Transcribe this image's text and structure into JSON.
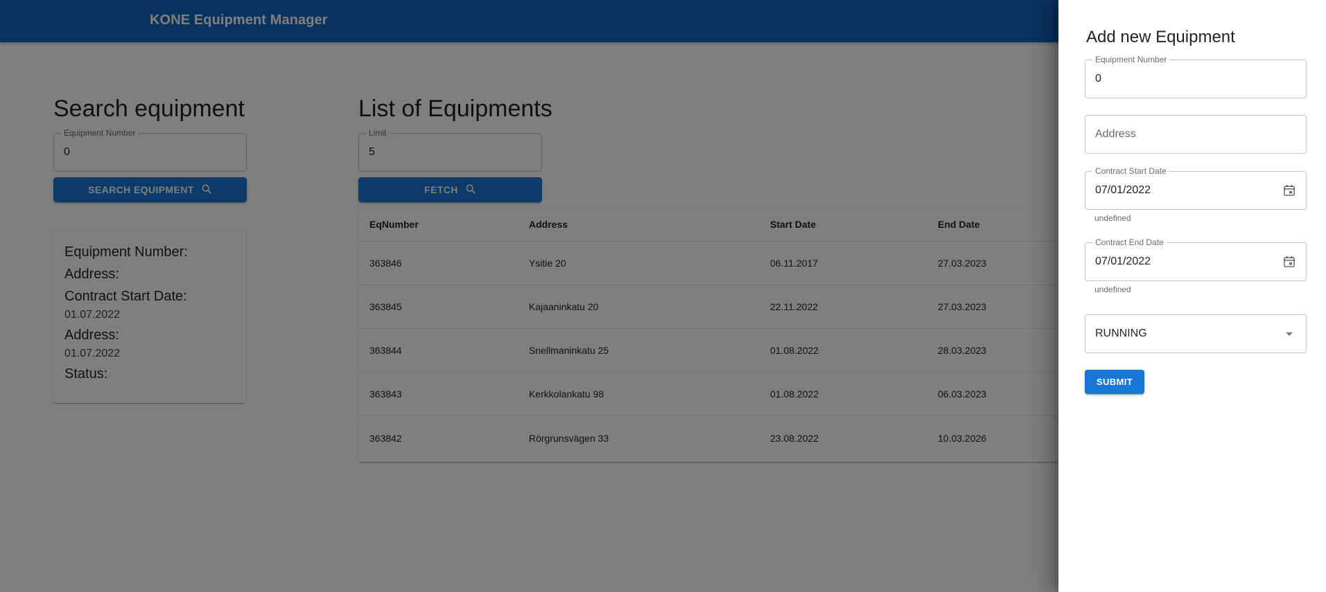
{
  "header": {
    "title": "KONE Equipment Manager"
  },
  "search": {
    "title": "Search equipment",
    "field_label": "Equipment Number",
    "field_value": "0",
    "button_label": "Search equipment"
  },
  "result_card": {
    "equipment_number_label": "Equipment Number:",
    "address_label": "Address:",
    "contract_start_label": "Contract Start Date:",
    "contract_start_value": "01.07.2022",
    "address2_label": "Address:",
    "address2_value": "01.07.2022",
    "status_label": "Status:"
  },
  "list": {
    "title": "List of Equipments",
    "limit_label": "Limit",
    "limit_value": "5",
    "fetch_label": "Fetch",
    "columns": [
      "EqNumber",
      "Address",
      "Start Date",
      "End Date"
    ],
    "rows": [
      [
        "363846",
        "Ysitie 20",
        "06.11.2017",
        "27.03.2023"
      ],
      [
        "363845",
        "Kajaaninkatu 20",
        "22.11.2022",
        "27.03.2023"
      ],
      [
        "363844",
        "Snellmaninkatu 25",
        "01.08.2022",
        "28.03.2023"
      ],
      [
        "363843",
        "Kerkkolankatu 98",
        "01.08.2022",
        "06.03.2023"
      ],
      [
        "363842",
        "Rörgrunsvägen 33",
        "23.08.2022",
        "10.03.2026"
      ]
    ]
  },
  "drawer": {
    "title": "Add new Equipment",
    "equipment_number_label": "Equipment Number",
    "equipment_number_value": "0",
    "address_placeholder": "Address",
    "contract_start_label": "Contract Start Date",
    "contract_start_value": "07/01/2022",
    "contract_start_helper": "undefined",
    "contract_end_label": "Contract End Date",
    "contract_end_value": "07/01/2022",
    "contract_end_helper": "undefined",
    "status_value": "RUNNING",
    "submit_label": "Submit"
  },
  "icons": {
    "search": "search-icon",
    "calendar": "calendar-icon",
    "dropdown": "chevron-down-icon"
  },
  "colors": {
    "primary": "#1565c0",
    "button": "#1976d2",
    "backdrop": "rgba(0,0,0,0.5)"
  }
}
